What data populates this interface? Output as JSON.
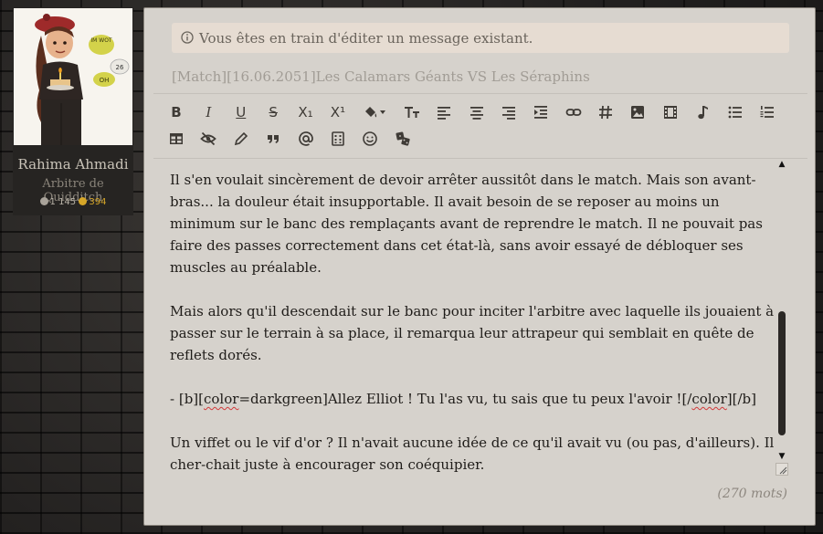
{
  "profile": {
    "avatar_bubble_1": "IM WOT",
    "avatar_bubble_2": "26",
    "avatar_bubble_3": "OH",
    "name": "Rahima Ahmadi",
    "rank": "Arbitre de Quidditch",
    "messages": "1 145",
    "coins": "394"
  },
  "editor": {
    "notice": "Vous êtes en train d'éditer un message existant.",
    "subject": "[Match][16.06.2051]Les Calamars Géants VS Les Séraphins",
    "toolbar_row1": [
      {
        "name": "bold-button",
        "label": "B"
      },
      {
        "name": "italic-button",
        "label": "I"
      },
      {
        "name": "underline-button",
        "label": "U"
      },
      {
        "name": "strikethrough-button",
        "label": "S"
      },
      {
        "name": "subscript-button",
        "label": "X₁"
      },
      {
        "name": "superscript-button",
        "label": "X¹"
      }
    ],
    "paragraphs": [
      "Il s'en voulait sincèrement de devoir arrêter aussitôt dans le match. Mais son avant-bras... la douleur était insupportable. Il avait besoin de se reposer au moins un minimum sur le banc des remplaçants avant de reprendre le match. Il ne pouvait pas faire des passes correctement dans cet état-là, sans avoir essayé de débloquer ses muscles au préalable.",
      "Mais alors qu'il descendait sur le banc pour inciter l'arbitre avec laquelle ils jouaient à passer sur le terrain à sa place, il remarqua leur attrapeur qui semblait en quête de reflets dorés.",
      "Un viffet ou le vif d'or ? Il n'avait aucune idée de ce qu'il avait vu (ou pas, d'ailleurs). Il cher-chait juste à encourager son coéquipier."
    ],
    "dialogue": {
      "prefix": "- [b][",
      "tag_color": "color",
      "tag_value": "=darkgreen]Allez Elliot ! Tu l'as vu, tu sais que tu peux l'avoir ![/",
      "tag_close": "color",
      "suffix": "][/b]"
    },
    "word_count": "(270 mots)"
  },
  "colors": {
    "editor_bg": "#d6d2cc",
    "notice_bg": "#e6dcd2",
    "spellcheck": "#d23a3a",
    "coin": "#d6a628"
  }
}
